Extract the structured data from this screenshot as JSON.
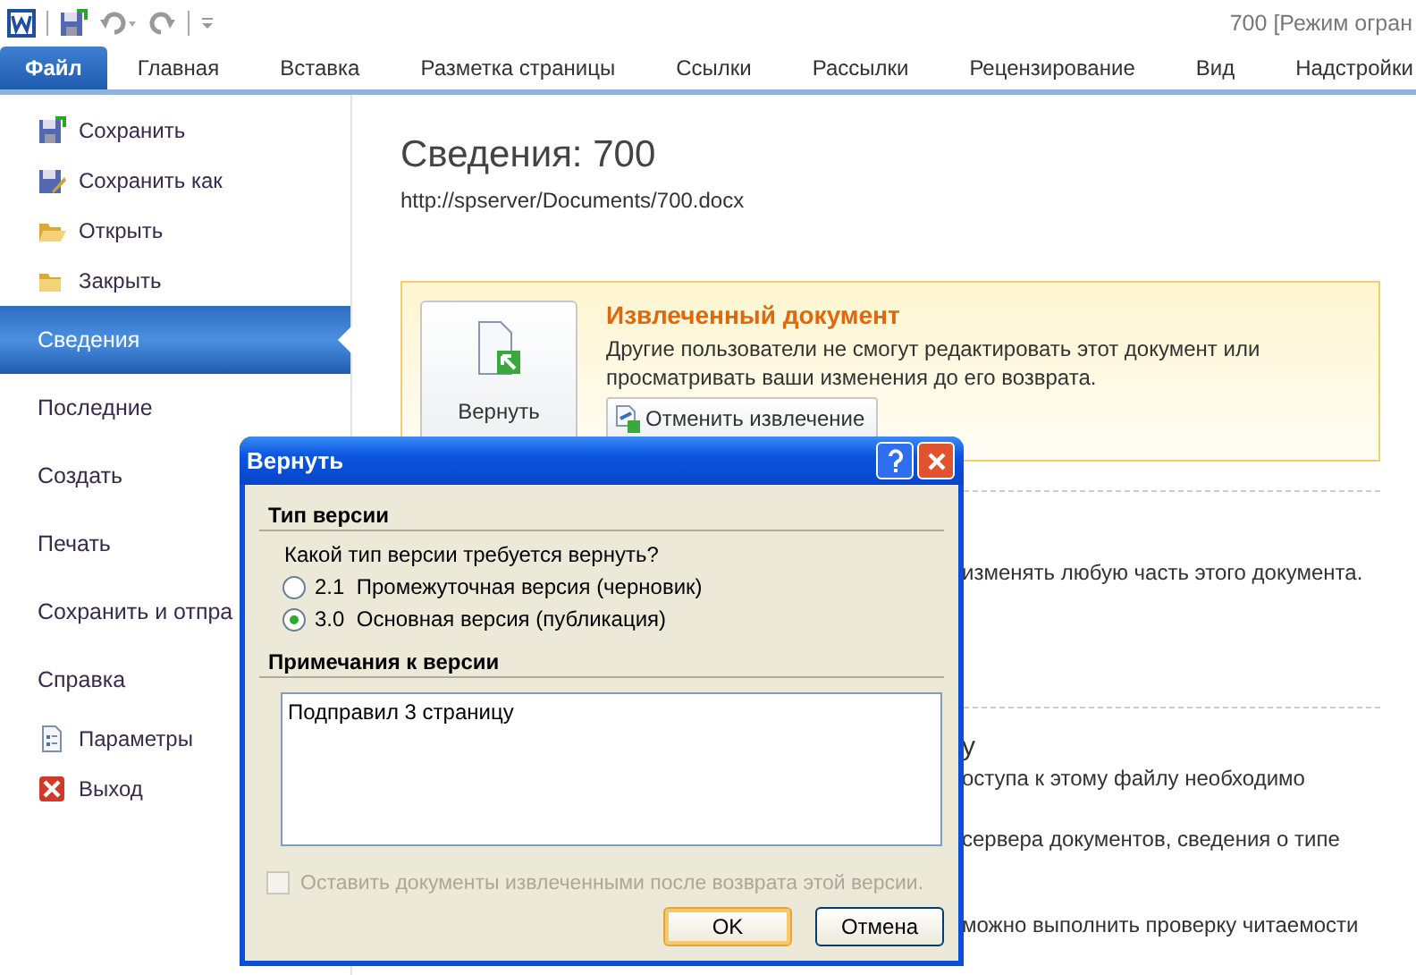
{
  "window": {
    "title": "700 [Режим огран"
  },
  "tabs": [
    {
      "label": "Файл",
      "selected": true
    },
    {
      "label": "Главная",
      "selected": false
    },
    {
      "label": "Вставка",
      "selected": false
    },
    {
      "label": "Разметка страницы",
      "selected": false
    },
    {
      "label": "Ссылки",
      "selected": false
    },
    {
      "label": "Рассылки",
      "selected": false
    },
    {
      "label": "Рецензирование",
      "selected": false
    },
    {
      "label": "Вид",
      "selected": false
    },
    {
      "label": "Надстройки",
      "selected": false
    }
  ],
  "sidebar": {
    "items": [
      {
        "label": "Сохранить",
        "kind": "small",
        "selected": false
      },
      {
        "label": "Сохранить как",
        "kind": "small",
        "selected": false
      },
      {
        "label": "Открыть",
        "kind": "small",
        "selected": false
      },
      {
        "label": "Закрыть",
        "kind": "small",
        "selected": false
      },
      {
        "label": "Сведения",
        "kind": "large",
        "selected": true
      },
      {
        "label": "Последние",
        "kind": "large",
        "selected": false
      },
      {
        "label": "Создать",
        "kind": "large",
        "selected": false
      },
      {
        "label": "Печать",
        "kind": "large",
        "selected": false
      },
      {
        "label": "Сохранить и отпра",
        "kind": "large",
        "selected": false
      },
      {
        "label": "Справка",
        "kind": "large",
        "selected": false
      },
      {
        "label": "Параметры",
        "kind": "small",
        "selected": false
      },
      {
        "label": "Выход",
        "kind": "small",
        "selected": false
      }
    ]
  },
  "info": {
    "title": "Сведения: 700",
    "path": "http://spserver/Documents/700.docx",
    "checkout": {
      "button": "Вернуть",
      "title": "Извлеченный документ",
      "text": "Другие пользователи не смогут редактировать этот документ или просматривать ваши изменения до его возврата.",
      "cancel_button": "Отменить извлечение"
    },
    "fragments": [
      {
        "kind": "text",
        "text": "изменять любую часть этого документа."
      },
      {
        "kind": "rule",
        "text": "у"
      },
      {
        "kind": "text",
        "text": "оступа к этому файлу необходимо"
      },
      {
        "kind": "text",
        "text": "сервера документов, сведения о типе"
      },
      {
        "kind": "text",
        "text": "можно выполнить проверку читаемости"
      }
    ]
  },
  "dialog": {
    "title": "Вернуть",
    "section_1": "Тип версии",
    "question": "Какой тип версии требуется вернуть?",
    "options": [
      {
        "version": "2.1",
        "label": "Промежуточная версия (черновик)",
        "selected": false
      },
      {
        "version": "3.0",
        "label": "Основная версия (публикация)",
        "selected": true
      }
    ],
    "section_2": "Примечания к версии",
    "notes": "Подправил 3 страницу",
    "keep_checkbox": {
      "label": "Оставить документы извлеченными после возврата этой версии.",
      "checked": false,
      "disabled": true
    },
    "buttons": [
      "OK",
      "Отмена"
    ]
  }
}
